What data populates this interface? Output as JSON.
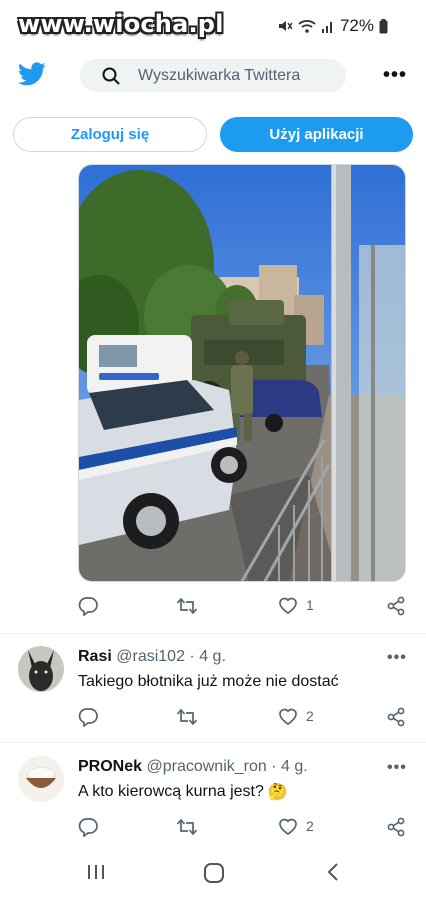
{
  "status_bar": {
    "watermark": "www.wiocha.pl",
    "battery": "72%",
    "icons": [
      "mute-icon",
      "wifi-icon",
      "signal-icon",
      "battery-icon"
    ]
  },
  "topbar": {
    "logo": "twitter-bird-icon",
    "search_placeholder": "Wyszukiwarka Twittera",
    "more_icon": "more-icon"
  },
  "auth": {
    "login_label": "Zaloguj się",
    "app_label": "Użyj aplikacji"
  },
  "tweet": {
    "media": "photo-police-car-and-armored-vehicle",
    "actions": {
      "reply": "",
      "retweet": "",
      "like": "1",
      "share": ""
    }
  },
  "replies": [
    {
      "name": "Rasi",
      "handle": "@rasi102",
      "time": "· 4 g.",
      "text": "Takiego błotnika już może nie dostać",
      "emoji": "",
      "likes": "2",
      "avatar": "dog-avatar"
    },
    {
      "name": "PRONek",
      "handle": "@pracownik_ron",
      "time": "· 4 g.",
      "text": "A kto kierowcą kurna jest?",
      "emoji": "🤔",
      "likes": "2",
      "avatar": "rice-bowl-avatar"
    }
  ],
  "colors": {
    "accent": "#1d9bf0",
    "secondary_text": "#536471",
    "search_bg": "#eff3f4"
  },
  "nav": [
    "recents-icon",
    "home-icon",
    "back-icon"
  ]
}
